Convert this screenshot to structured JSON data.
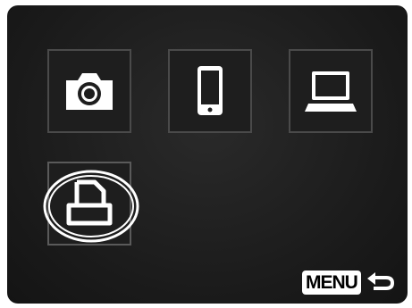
{
  "menu": {
    "items": [
      {
        "icon": "camera-icon",
        "selected": false
      },
      {
        "icon": "smartphone-icon",
        "selected": false
      },
      {
        "icon": "laptop-icon",
        "selected": false
      },
      {
        "icon": "printer-icon",
        "selected": true
      }
    ]
  },
  "footer": {
    "menu_label": "MENU",
    "back_icon": "back-arrow-icon"
  },
  "colors": {
    "background": "#1a1a1a",
    "tile_border": "#4a4a4a",
    "icon": "#ffffff"
  }
}
